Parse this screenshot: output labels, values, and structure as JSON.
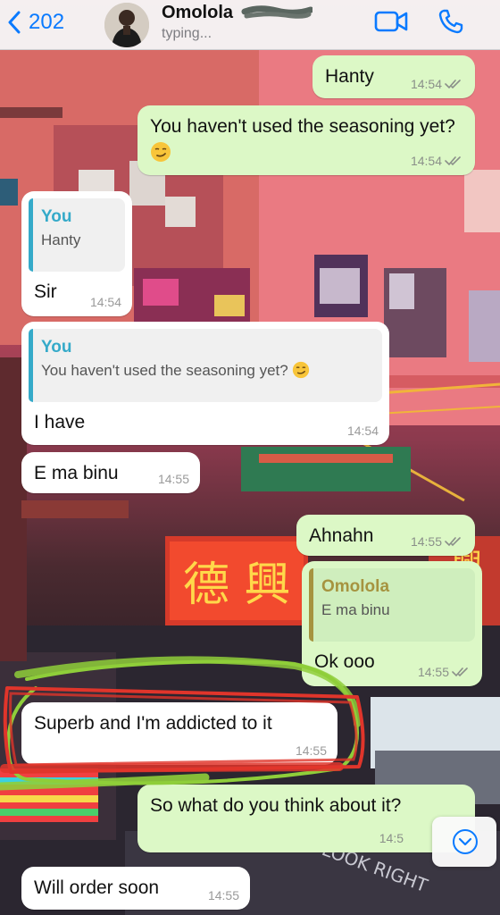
{
  "header": {
    "back_count": "202",
    "contact_name": "Omolola",
    "status": "typing..."
  },
  "messages": [
    {
      "id": "m1",
      "direction": "outgoing",
      "text": "Hanty",
      "time": "14:54",
      "read": true
    },
    {
      "id": "m2",
      "direction": "outgoing",
      "text": "You haven't used the seasoning yet?",
      "emoji": "smirking-face",
      "time": "14:54",
      "read": true
    },
    {
      "id": "m3",
      "direction": "incoming",
      "quote": {
        "author": "You",
        "text": "Hanty"
      },
      "text": "Sir",
      "time": "14:54"
    },
    {
      "id": "m4",
      "direction": "incoming",
      "quote": {
        "author": "You",
        "text": "You haven't used the seasoning yet?",
        "emoji": "smirking-face"
      },
      "text": "I have",
      "time": "14:54"
    },
    {
      "id": "m5",
      "direction": "incoming",
      "text": "E ma binu",
      "time": "14:55"
    },
    {
      "id": "m6",
      "direction": "outgoing",
      "text": "Ahnahn",
      "time": "14:55",
      "read": true
    },
    {
      "id": "m7",
      "direction": "outgoing",
      "quote": {
        "author": "Omolola",
        "text": "E ma binu"
      },
      "text": "Ok ooo",
      "time": "14:55",
      "read": true
    },
    {
      "id": "m8",
      "direction": "incoming",
      "text": "Superb and I'm addicted to it",
      "time": "14:55"
    },
    {
      "id": "m9",
      "direction": "outgoing",
      "text": "So what do you think about it?",
      "time": "14:5"
    },
    {
      "id": "m10",
      "direction": "incoming",
      "text": "Will order soon",
      "time": "14:55"
    }
  ],
  "icons": {
    "back": "chevron-left-icon",
    "video": "video-camera-icon",
    "call": "phone-icon",
    "scroll": "chevron-down-circle-icon",
    "read_receipt": "double-check-icon"
  },
  "colors": {
    "accent": "#0a7aff",
    "outgoing_bubble": "#dcf8c6",
    "incoming_bubble": "#ffffff",
    "quote_you": "#35aac9",
    "quote_contact": "#a6933f",
    "scribble_green": "#8fce3a",
    "scribble_red": "#e0352b"
  }
}
